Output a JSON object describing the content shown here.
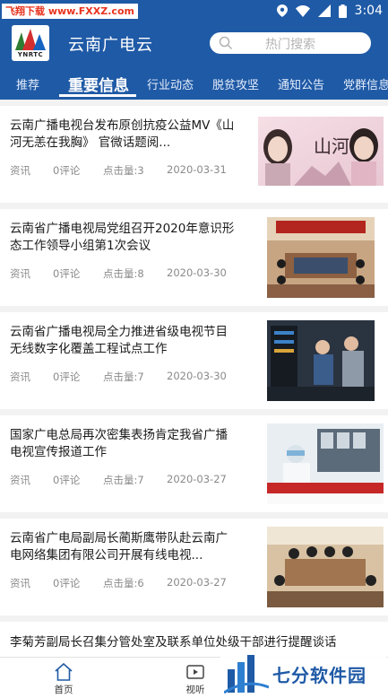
{
  "status_bar": {
    "watermark": "飞翔下载 www.FXXZ.com",
    "time": "3:04"
  },
  "header": {
    "logo_text": "YNRTC",
    "title": "云南广电云",
    "search_placeholder": "热门搜索"
  },
  "tabs": [
    {
      "label": "推荐"
    },
    {
      "label": "重要信息"
    },
    {
      "label": "行业动态"
    },
    {
      "label": "脱贫攻坚"
    },
    {
      "label": "通知公告"
    },
    {
      "label": "党群信息"
    }
  ],
  "news": [
    {
      "title": "云南广播电视台发布原创抗疫公益MV《山河无恙在我胸》 官微话题阅...",
      "category": "资讯",
      "comments": "0评论",
      "views": "点击量:3",
      "date": "2020-03-31",
      "thumb_caption": "山河"
    },
    {
      "title": "云南省广播电视局党组召开2020年意识形态工作领导小组第1次会议",
      "category": "资讯",
      "comments": "0评论",
      "views": "点击量:8",
      "date": "2020-03-30"
    },
    {
      "title": "云南省广播电视局全力推进省级电视节目无线数字化覆盖工程试点工作",
      "category": "资讯",
      "comments": "0评论",
      "views": "点击量:7",
      "date": "2020-03-30"
    },
    {
      "title": "国家广电总局再次密集表扬肯定我省广播电视宣传报道工作",
      "category": "资讯",
      "comments": "0评论",
      "views": "点击量:7",
      "date": "2020-03-27"
    },
    {
      "title": "云南省广电局副局长蔺斯鹰带队赴云南广电网络集团有限公司开展有线电视...",
      "category": "资讯",
      "comments": "0评论",
      "views": "点击量:6",
      "date": "2020-03-27"
    }
  ],
  "last_item": {
    "title": "李菊芳副局长召集分管处室及联系单位处级干部进行提醒谈话"
  },
  "bottom_nav": [
    {
      "label": "首页",
      "icon": "home-icon"
    },
    {
      "label": "视听",
      "icon": "video-icon"
    }
  ],
  "brand_watermark": {
    "text": "七分软件园"
  },
  "colors": {
    "header_bg": "#1f5aa6",
    "meta_gray": "#8a8a8a",
    "separator": "#f2f2f2"
  }
}
